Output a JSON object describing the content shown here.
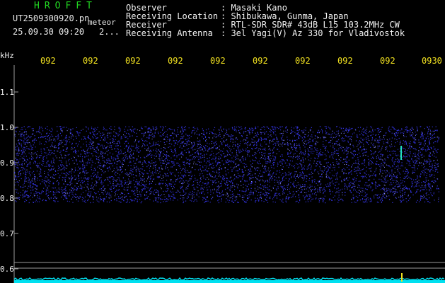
{
  "header": {
    "app_title": "HROFFT",
    "filename": "UT2509300920.pn",
    "filename_suffix": "meteor",
    "datetime": "25.09.30 09:20",
    "datetime_suffix": "2..."
  },
  "info": [
    {
      "label": "Observer",
      "value": ": Masaki Kano"
    },
    {
      "label": "Receiving Location",
      "value": ": Shibukawa, Gunma, Japan"
    },
    {
      "label": "Receiver",
      "value": ": RTL-SDR SDR# 43dB L15 103.2MHz CW"
    },
    {
      "label": "Receiving Antenna",
      "value": ": 3el Yagi(V) Az 330 for Vladivostok"
    }
  ],
  "axis": {
    "unit": "kHz",
    "top_ticks": [
      "092",
      "092",
      "092",
      "092",
      "092",
      "092",
      "092",
      "092",
      "092",
      "0930"
    ],
    "y_ticks": [
      "1.1",
      "1.0",
      "0.9",
      "0.8",
      "0.7",
      "0.6"
    ]
  },
  "colors": {
    "background": "#000000",
    "title": "#22d822",
    "tick_text": "#f0e020",
    "signal": "#3a3aff",
    "baseline": "#00e0f0",
    "axis_lines": "#9a9a9a"
  }
}
